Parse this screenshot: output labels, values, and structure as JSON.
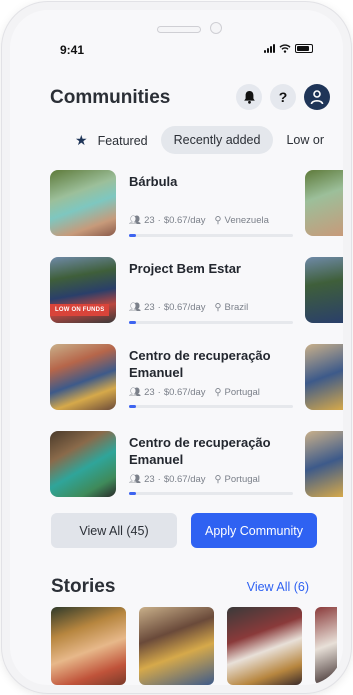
{
  "status_bar": {
    "time": "9:41"
  },
  "header": {
    "title": "Communities",
    "help_label": "?"
  },
  "tabs": [
    {
      "label": "Featured",
      "icon": "star-icon"
    },
    {
      "label": "Recently added"
    },
    {
      "label": "Low or"
    }
  ],
  "communities": [
    {
      "name": "Bárbula",
      "people": "23",
      "rate": "$0.67/day",
      "location": "Venezuela",
      "badge": "",
      "progress": 0.04
    },
    {
      "name": "Project Bem Estar",
      "people": "23",
      "rate": "$0.67/day",
      "location": "Brazil",
      "badge": "LOW ON FUNDS",
      "progress": 0.04
    },
    {
      "name": "Centro de recuperação Emanuel",
      "people": "23",
      "rate": "$0.67/day",
      "location": "Portugal",
      "badge": "",
      "progress": 0.04
    },
    {
      "name": "Centro de recuperação Emanuel",
      "people": "23",
      "rate": "$0.67/day",
      "location": "Portugal",
      "badge": "",
      "progress": 0.04
    }
  ],
  "meta_separator": "·",
  "actions": {
    "view_all": "View All (45)",
    "apply": "Apply Community"
  },
  "stories": {
    "title": "Stories",
    "view_all": "View All (6)"
  },
  "colors": {
    "accent": "#2f62f2",
    "navy": "#1f3558",
    "badge": "#d9443a"
  }
}
